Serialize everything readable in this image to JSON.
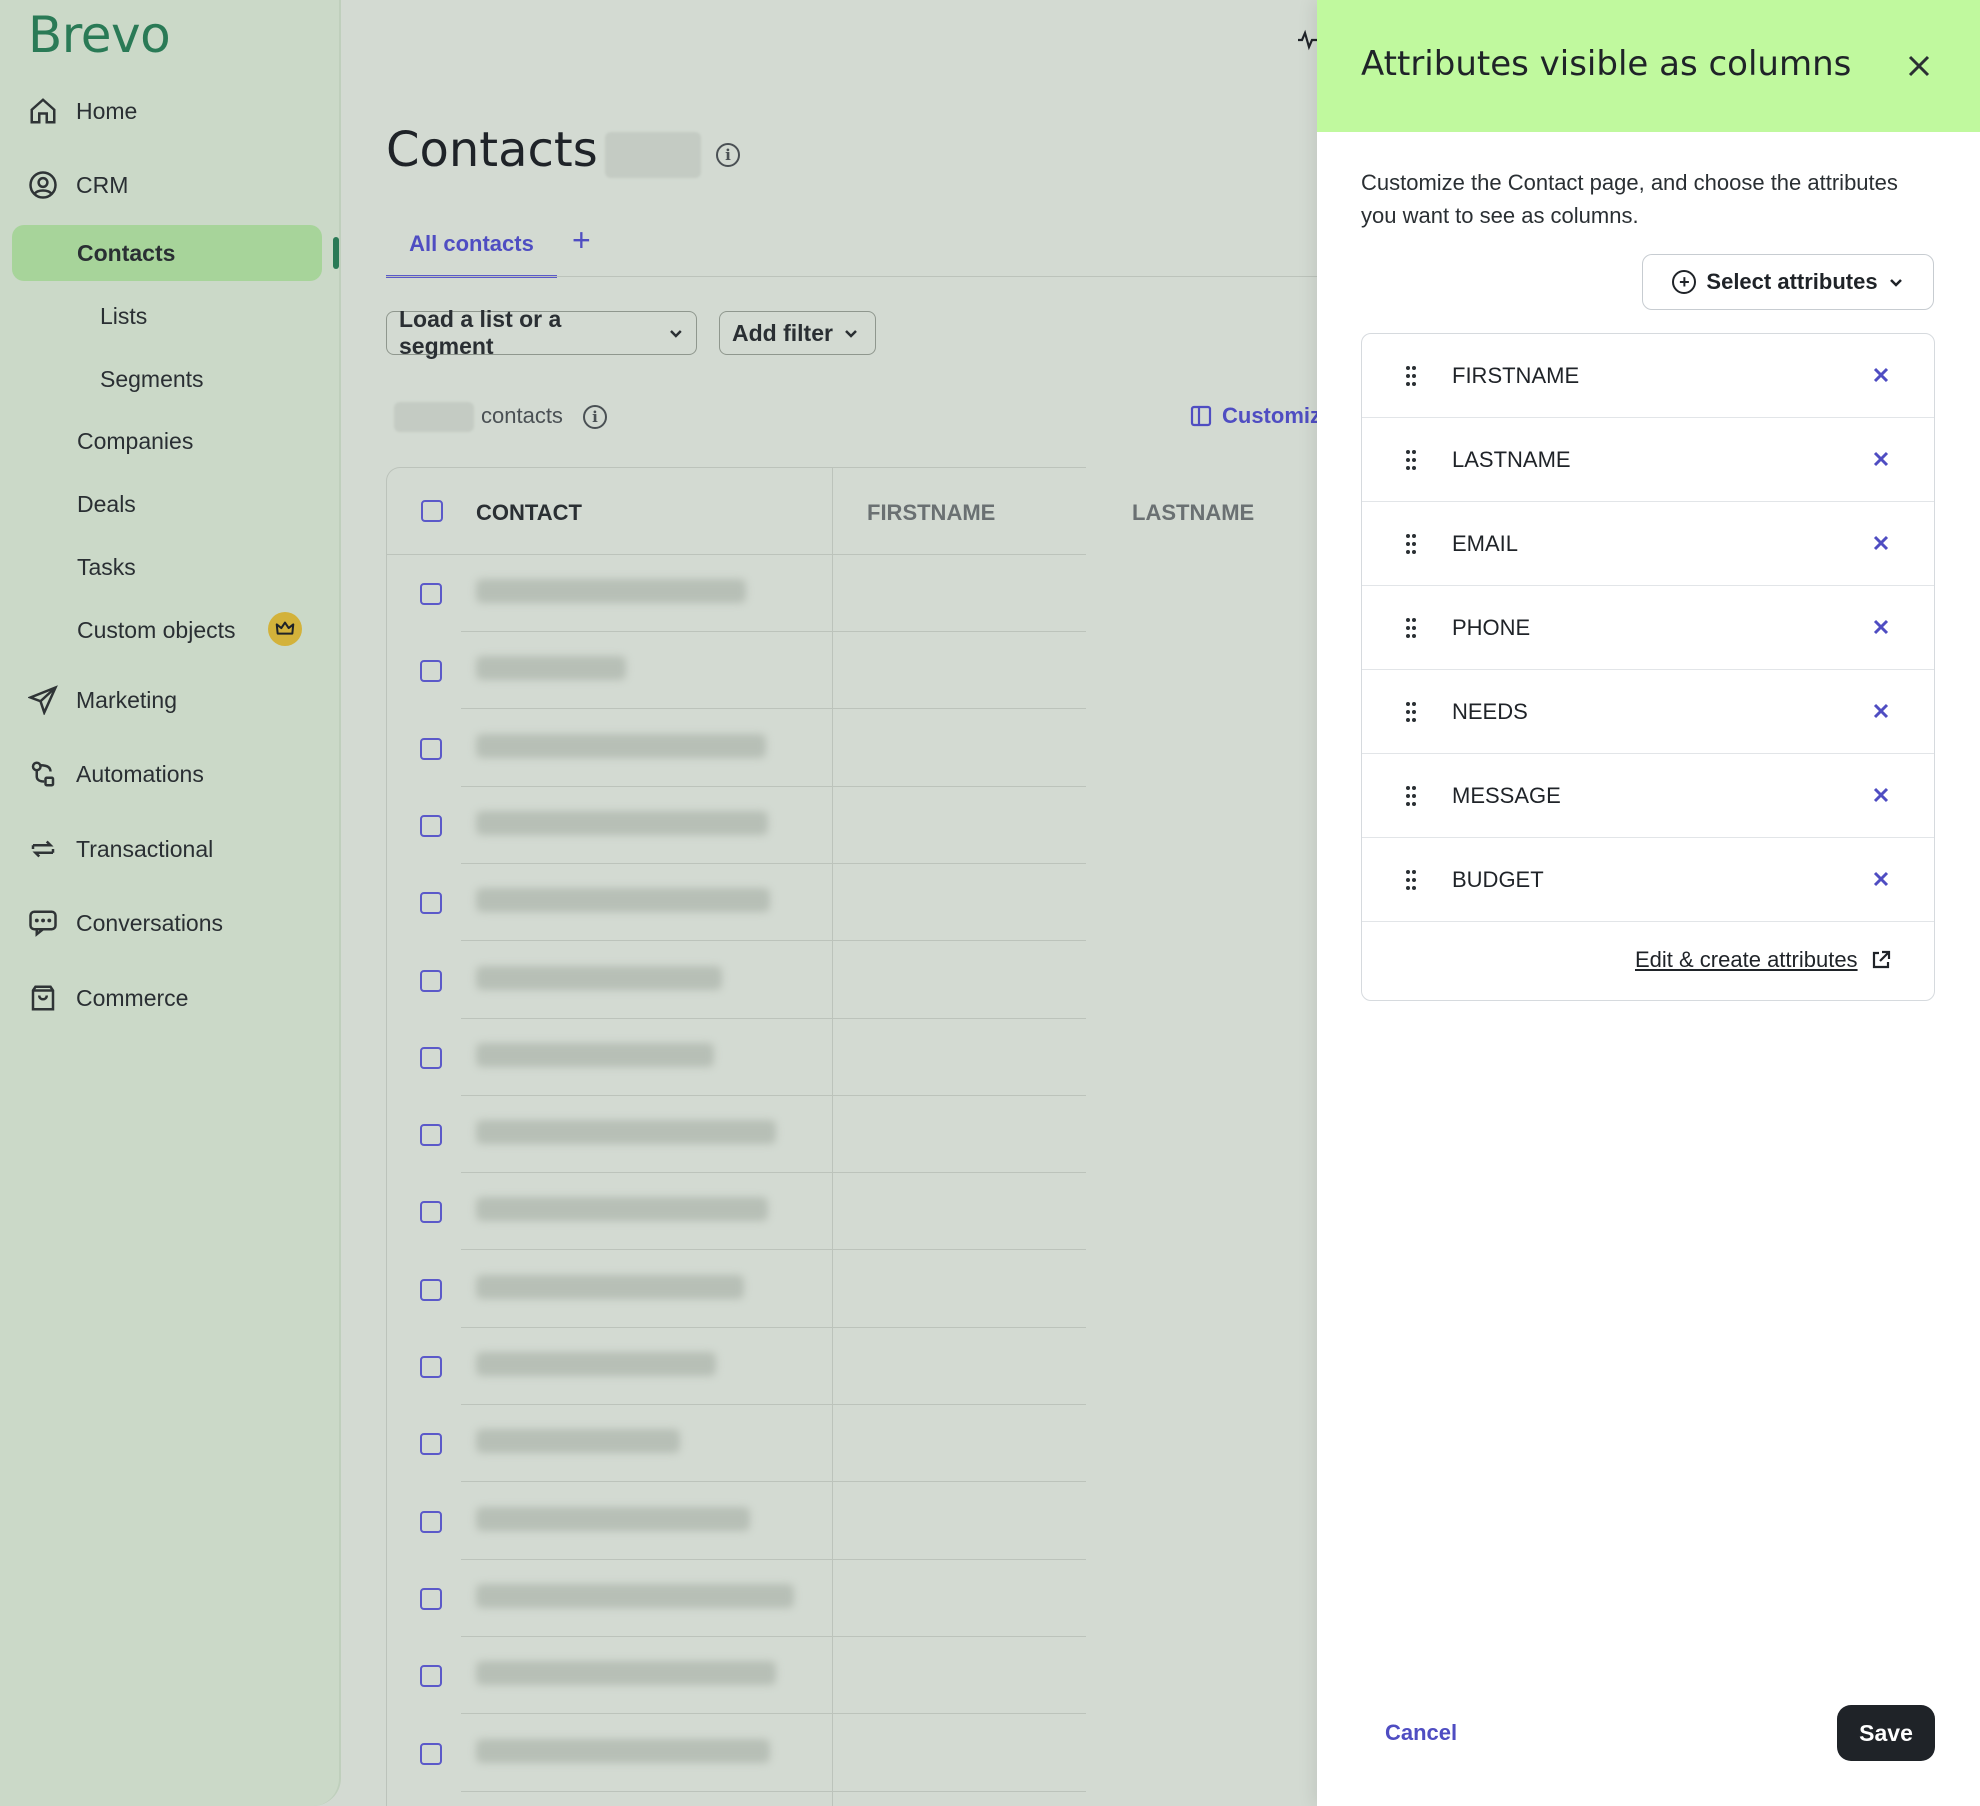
{
  "brand": {
    "logo_text": "Brevo",
    "accent": "#2a7a56",
    "panel_header_bg": "#c0f99e",
    "link_color": "#4f4dc2"
  },
  "sidebar": {
    "items": [
      {
        "label": "Home",
        "icon": "home-icon"
      },
      {
        "label": "CRM",
        "icon": "user-circle-icon"
      },
      {
        "label": "Marketing",
        "icon": "send-icon"
      },
      {
        "label": "Automations",
        "icon": "automation-icon"
      },
      {
        "label": "Transactional",
        "icon": "sync-icon"
      },
      {
        "label": "Conversations",
        "icon": "chat-icon"
      },
      {
        "label": "Commerce",
        "icon": "bag-icon"
      }
    ],
    "crm_children": [
      {
        "label": "Contacts",
        "active": true
      },
      {
        "label": "Lists"
      },
      {
        "label": "Segments"
      },
      {
        "label": "Companies"
      },
      {
        "label": "Deals"
      },
      {
        "label": "Tasks"
      },
      {
        "label": "Custom objects",
        "badge": "crown-icon"
      }
    ]
  },
  "main": {
    "title": "Contacts",
    "tabs": [
      {
        "label": "All contacts",
        "active": true
      }
    ],
    "tab_add": "+",
    "filters": {
      "list_label": "Load a list or a segment",
      "filter_label": "Add filter"
    },
    "count_label": "contacts",
    "customize_label": "Customiz",
    "table": {
      "columns": [
        "CONTACT",
        "FIRSTNAME",
        "LASTNAME"
      ],
      "row_count": 16
    }
  },
  "panel": {
    "title": "Attributes visible as columns",
    "description": "Customize the Contact page, and choose the attributes you want to see as columns.",
    "select_label": "Select attributes",
    "attributes": [
      "FIRSTNAME",
      "LASTNAME",
      "EMAIL",
      "PHONE",
      "NEEDS",
      "MESSAGE",
      "BUDGET"
    ],
    "edit_link": "Edit & create attributes",
    "cancel_label": "Cancel",
    "save_label": "Save"
  }
}
